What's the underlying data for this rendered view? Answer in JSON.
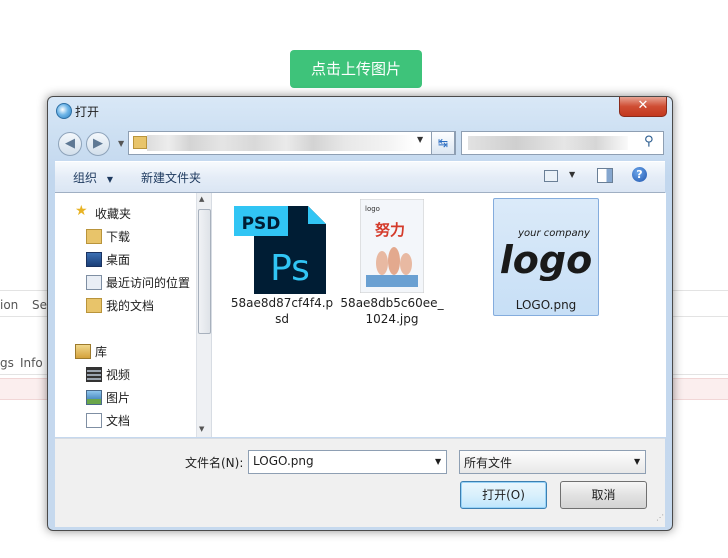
{
  "page": {
    "upload_button": "点击上传图片",
    "bg_tabs": [
      "ion",
      "Se",
      "gs",
      "Info"
    ]
  },
  "dialog": {
    "title": "打开",
    "close_label": "✕",
    "refresh_label": "↹",
    "toolbar": {
      "organize": "组织",
      "new_folder": "新建文件夹",
      "help_label": "?"
    },
    "nav_pane": {
      "items": [
        {
          "label": "收藏夹",
          "icon": "star-icon"
        },
        {
          "label": "下载",
          "icon": "download-folder-icon"
        },
        {
          "label": "桌面",
          "icon": "desktop-icon"
        },
        {
          "label": "最近访问的位置",
          "icon": "recent-places-icon"
        },
        {
          "label": "我的文档",
          "icon": "documents-folder-icon"
        },
        {
          "label": "库",
          "icon": "library-icon"
        },
        {
          "label": "视频",
          "icon": "video-icon"
        },
        {
          "label": "图片",
          "icon": "pictures-icon"
        },
        {
          "label": "文档",
          "icon": "document-icon"
        }
      ]
    },
    "files": [
      {
        "name": "58ae8d87cf4f4.psd",
        "thumb_label": "PSD",
        "thumb_text": "Ps"
      },
      {
        "name": "58ae8db5c60ee_1024.jpg",
        "thumb_label": "logo",
        "thumb_text": "努力"
      },
      {
        "name": "LOGO.png",
        "thumb_label": "your company",
        "thumb_text": "logo",
        "selected": true
      }
    ],
    "filename_label": "文件名(N):",
    "filename_value": "LOGO.png",
    "file_type": "所有文件",
    "open_button": "打开(O)",
    "cancel_button": "取消"
  },
  "colors": {
    "upload_green": "#3ec37a",
    "ps_blue": "#31c5f4",
    "ps_dark": "#001d34",
    "selection_blue": "#c7dff6"
  }
}
